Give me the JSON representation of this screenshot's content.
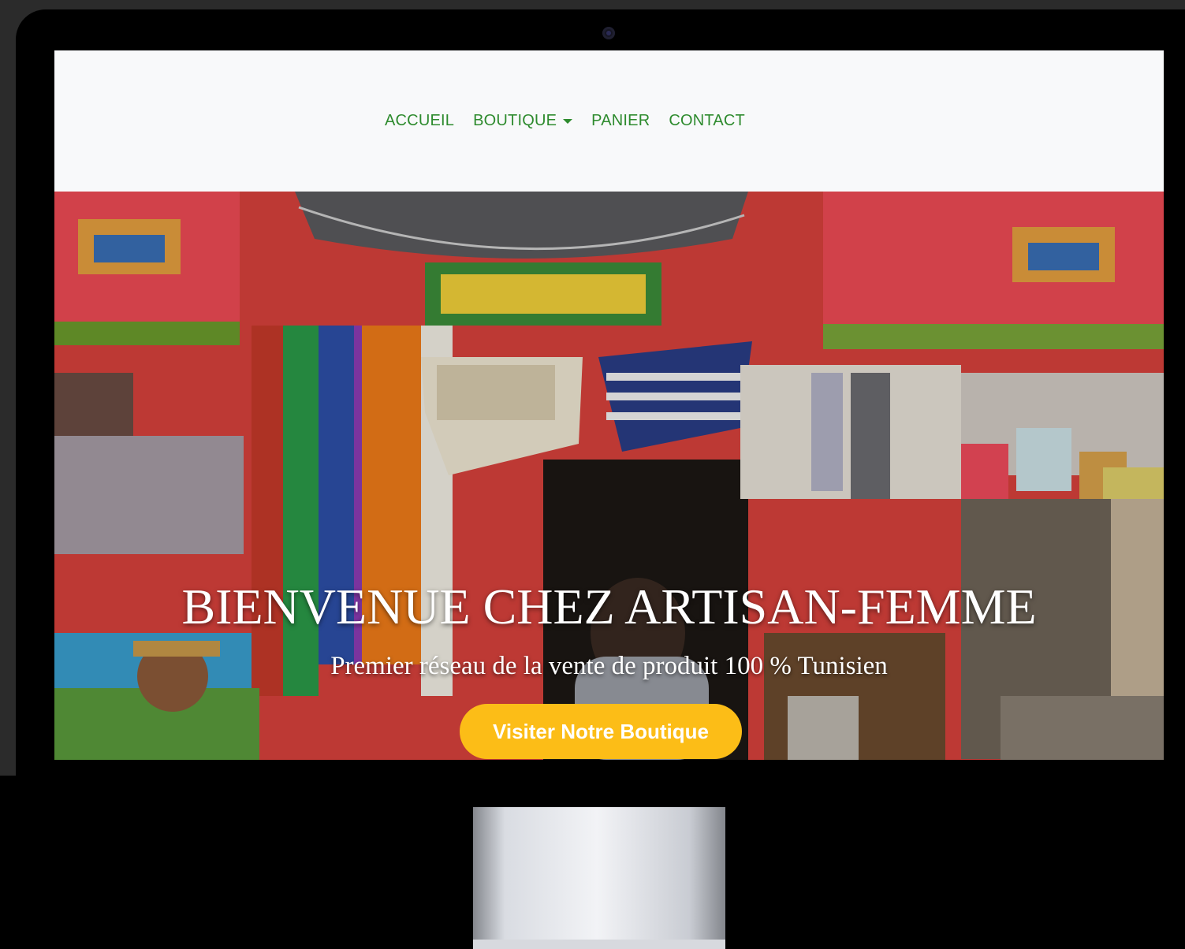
{
  "nav": {
    "items": [
      {
        "label": "ACCUEIL"
      },
      {
        "label": "BOUTIQUE",
        "has_dropdown": true
      },
      {
        "label": "PANIER"
      },
      {
        "label": "CONTACT"
      }
    ],
    "link_color": "#2e8b2e"
  },
  "hero": {
    "title": "BIENVENUE CHEZ ARTISAN-FEMME",
    "subtitle": "Premier réseau de la vente de produit 100 % Tunisien",
    "cta_label": "Visiter Notre Boutique",
    "cta_color": "#fcbd17",
    "background_image": "colorful-craft-shop-photo"
  },
  "device": {
    "type": "desktop-monitor-mockup",
    "icon": "camera-icon"
  }
}
